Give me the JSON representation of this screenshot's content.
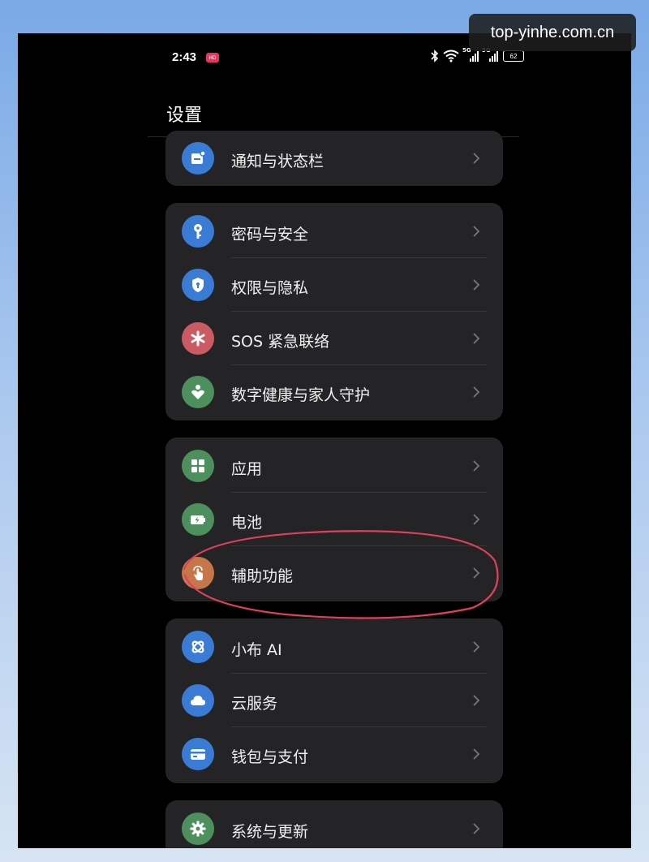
{
  "watermark": "top-yinhe.com.cn",
  "status_bar": {
    "time": "2:43",
    "network_label_1": "5G",
    "network_label_2": "5G",
    "battery_level": "62"
  },
  "header": {
    "title": "设置"
  },
  "groups": [
    {
      "items": [
        {
          "label": "通知与状态栏",
          "icon": "notification-icon",
          "color": "#3a7bd5"
        }
      ]
    },
    {
      "items": [
        {
          "label": "密码与安全",
          "icon": "key-icon",
          "color": "#3a7bd5"
        },
        {
          "label": "权限与隐私",
          "icon": "shield-icon",
          "color": "#3a7bd5"
        },
        {
          "label": "SOS 紧急联络",
          "icon": "sos-asterisk-icon",
          "color": "#cc5a62"
        },
        {
          "label": "数字健康与家人守护",
          "icon": "heart-person-icon",
          "color": "#4e8f5e"
        }
      ]
    },
    {
      "items": [
        {
          "label": "应用",
          "icon": "apps-grid-icon",
          "color": "#4e8f5e"
        },
        {
          "label": "电池",
          "icon": "battery-icon",
          "color": "#4e8f5e"
        },
        {
          "label": "辅助功能",
          "icon": "accessibility-hand-icon",
          "color": "#c7764a"
        }
      ]
    },
    {
      "items": [
        {
          "label": "小布 AI",
          "icon": "ai-assistant-icon",
          "color": "#3a7bd5"
        },
        {
          "label": "云服务",
          "icon": "cloud-icon",
          "color": "#3a7bd5"
        },
        {
          "label": "钱包与支付",
          "icon": "wallet-icon",
          "color": "#3a7bd5"
        }
      ]
    },
    {
      "items": [
        {
          "label": "系统与更新",
          "icon": "gear-icon",
          "color": "#4e8f5e"
        }
      ]
    }
  ],
  "annotation": {
    "circle_color": "#e0405a"
  }
}
